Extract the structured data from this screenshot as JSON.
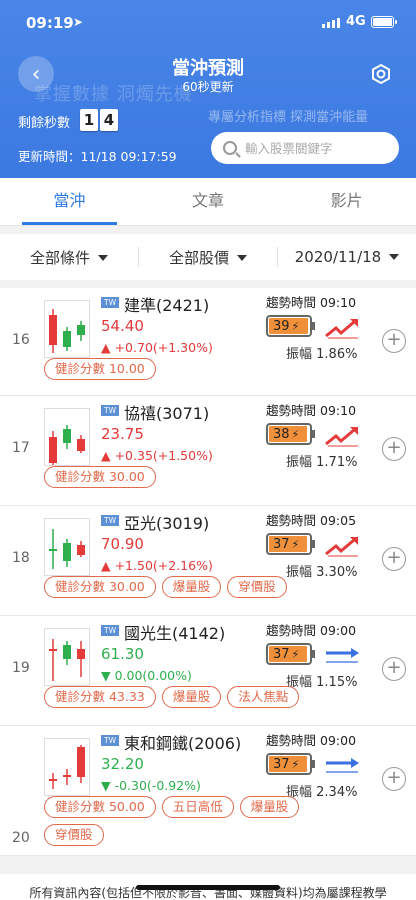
{
  "status": {
    "time": "09:19",
    "network": "4G"
  },
  "header": {
    "title": "當沖預測",
    "subtitle": "60秒更新",
    "watermark_left": "掌握數據 洞燭先機",
    "watermark_right": "專屬分析指標 探測當沖能量",
    "countdown_label": "剩餘秒數",
    "countdown_digits": [
      "1",
      "4"
    ],
    "update_time": "更新時間：11/18 09:17:59",
    "search_placeholder": "輸入股票關鍵字"
  },
  "tabs": [
    {
      "label": "當沖",
      "active": true
    },
    {
      "label": "文章",
      "active": false
    },
    {
      "label": "影片",
      "active": false
    }
  ],
  "filters": [
    {
      "label": "全部條件"
    },
    {
      "label": "全部股價"
    },
    {
      "label": "2020/11/18"
    }
  ],
  "trend_label_prefix": "趨勢時間",
  "amp_label_prefix": "振幅",
  "stocks": [
    {
      "rank": "16",
      "market": "TW",
      "name": "建準(2421)",
      "price": "54.40",
      "change": "▲ +0.70(+1.30%)",
      "dir": "up",
      "trend_time": "09:10",
      "energy": "39",
      "energy_level": 0.39,
      "trend_icon": "sharp-up-arrow-icon",
      "amplitude": "1.86%",
      "tags": [
        "健診分數 10.00"
      ]
    },
    {
      "rank": "17",
      "market": "TW",
      "name": "協禧(3071)",
      "price": "23.75",
      "change": "▲ +0.35(+1.50%)",
      "dir": "up",
      "trend_time": "09:10",
      "energy": "38",
      "energy_level": 0.38,
      "trend_icon": "sharp-up-arrow-icon",
      "amplitude": "1.71%",
      "tags": [
        "健診分數 30.00"
      ]
    },
    {
      "rank": "18",
      "market": "TW",
      "name": "亞光(3019)",
      "price": "70.90",
      "change": "▲ +1.50(+2.16%)",
      "dir": "up",
      "trend_time": "09:05",
      "energy": "37",
      "energy_level": 0.37,
      "trend_icon": "sharp-up-arrow-icon",
      "amplitude": "3.30%",
      "tags": [
        "健診分數 30.00",
        "爆量股",
        "穿價股"
      ]
    },
    {
      "rank": "19",
      "market": "TW",
      "name": "國光生(4142)",
      "price": "61.30",
      "change": "▼ 0.00(0.00%)",
      "dir": "down",
      "trend_time": "09:00",
      "energy": "37",
      "energy_level": 0.37,
      "trend_icon": "flat-right-arrow-icon",
      "amplitude": "1.15%",
      "tags": [
        "健診分數 43.33",
        "爆量股",
        "法人焦點"
      ]
    },
    {
      "rank": "20",
      "market": "TW",
      "name": "東和鋼鐵(2006)",
      "price": "32.20",
      "change": "▼ -0.30(-0.92%)",
      "dir": "down",
      "trend_time": "09:00",
      "energy": "37",
      "energy_level": 0.37,
      "trend_icon": "flat-right-arrow-icon",
      "amplitude": "2.34%",
      "tags": [
        "健診分數 50.00",
        "五日高低",
        "爆量股",
        "穿價股"
      ]
    }
  ],
  "footer_text": "所有資訊內容(包括但不限於影音、書面、媒體資料)均為屬課程教學",
  "colors": {
    "up": "#e43a3a",
    "down": "#2fae4e",
    "accent": "#2e7be6",
    "header": "#4a86e8",
    "energy": "#f0903a",
    "tag": "#e2694a"
  }
}
